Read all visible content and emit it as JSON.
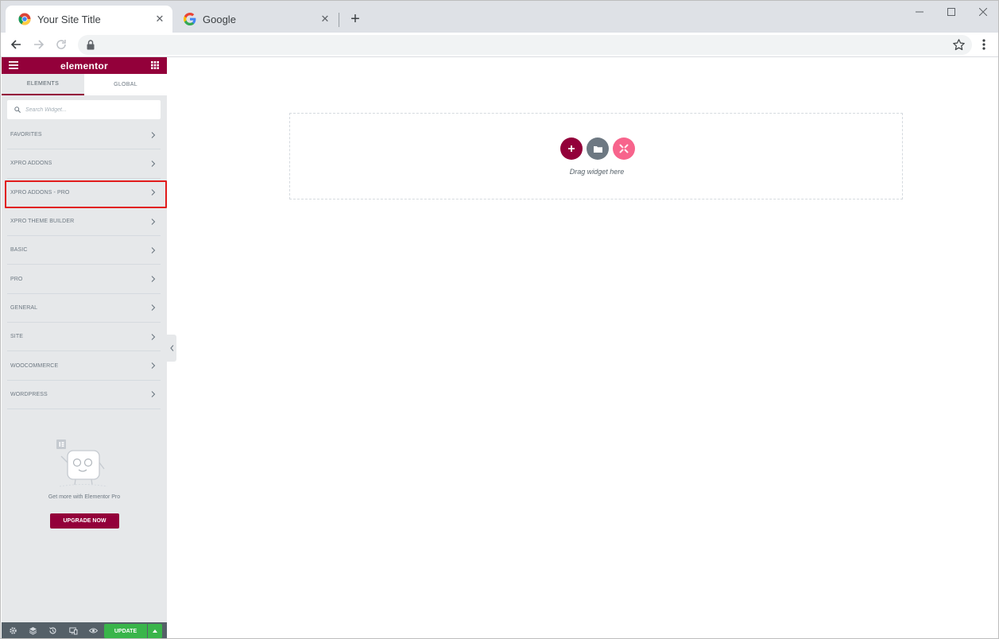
{
  "browser": {
    "tabs": [
      {
        "title": "Your Site Title",
        "active": true,
        "icon": "chrome-icon"
      },
      {
        "title": "Google",
        "active": false,
        "icon": "google-g-icon"
      }
    ],
    "close_glyph": "✕",
    "new_tab_glyph": "+"
  },
  "elementor": {
    "logo": "elementor",
    "tabs": {
      "elements": "ELEMENTS",
      "global": "GLOBAL"
    },
    "search_placeholder": "Search Widget...",
    "categories": [
      "FAVORITES",
      "XPRO ADDONS",
      "XPRO ADDONS - PRO",
      "XPRO THEME BUILDER",
      "BASIC",
      "PRO",
      "GENERAL",
      "SITE",
      "WOOCOMMERCE",
      "WORDPRESS"
    ],
    "highlighted_category": "XPRO ADDONS - PRO",
    "promo_text": "Get more with Elementor Pro",
    "upgrade_label": "UPGRADE NOW",
    "update_label": "UPDATE",
    "colors": {
      "brand": "#93003a",
      "update": "#39b54a",
      "footer": "#556068",
      "highlight": "#e11b1b"
    }
  },
  "canvas": {
    "drop_text": "Drag widget here"
  }
}
